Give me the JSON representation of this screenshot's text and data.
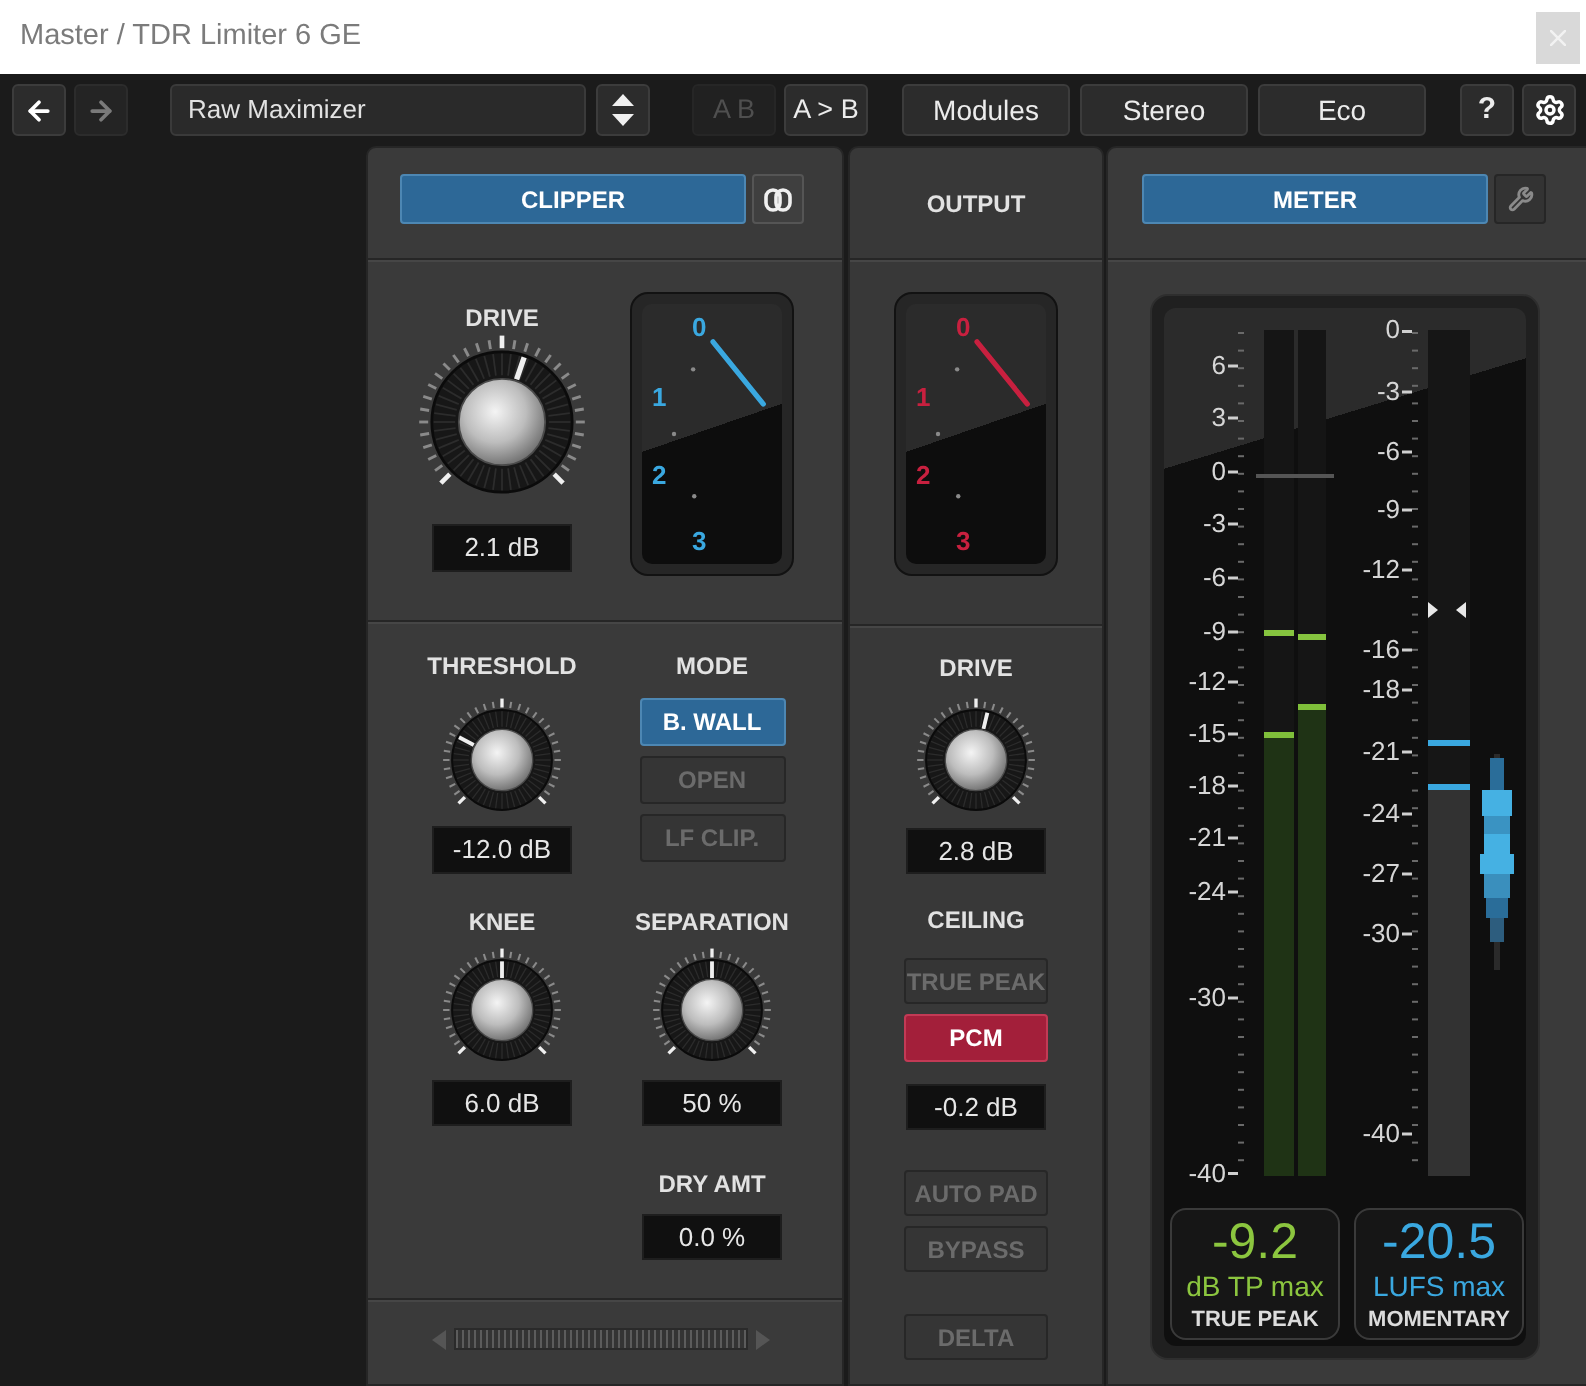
{
  "window": {
    "title": "Master / TDR Limiter 6 GE"
  },
  "toolbar": {
    "nav": [
      {
        "kind": "back",
        "disabled": false
      },
      {
        "kind": "forward",
        "disabled": true
      }
    ],
    "preset": "Raw Maximizer",
    "ab": [
      {
        "label": "A B",
        "disabled": true
      },
      {
        "label": "A > B",
        "disabled": false
      }
    ],
    "buttons": [
      {
        "label": "Modules"
      },
      {
        "label": "Stereo"
      },
      {
        "label": "Eco"
      }
    ],
    "help": "?"
  },
  "clipper": {
    "header": {
      "label": "CLIPPER",
      "on": true
    },
    "drive": {
      "label": "DRIVE",
      "value": "2.1 dB",
      "level": 0.57
    },
    "gr_meter": {
      "scale": [
        "0",
        "1",
        "2",
        "3"
      ]
    },
    "threshold": {
      "label": "THRESHOLD",
      "value": "-12.0 dB",
      "level": 0.27
    },
    "mode": {
      "label": "MODE",
      "options": [
        {
          "label": "B. WALL",
          "selected": true
        },
        {
          "label": "OPEN",
          "selected": false
        },
        {
          "label": "LF CLIP.",
          "selected": false
        }
      ]
    },
    "knee": {
      "label": "KNEE",
      "value": "6.0 dB",
      "level": 0.5
    },
    "separation": {
      "label": "SEPARATION",
      "value": "50 %",
      "level": 0.5
    },
    "dry_amount": {
      "label": "DRY AMT",
      "value": "0.0 %"
    }
  },
  "output": {
    "title": "OUTPUT",
    "gr_meter": {
      "scale": [
        "0",
        "1",
        "2",
        "3"
      ]
    },
    "drive": {
      "label": "DRIVE",
      "value": "2.8 dB",
      "level": 0.55
    },
    "ceiling": {
      "label": "CEILING",
      "options": [
        {
          "label": "TRUE PEAK",
          "selected": false
        },
        {
          "label": "PCM",
          "selected": true
        }
      ],
      "value": "-0.2 dB"
    },
    "buttons": [
      {
        "label": "AUTO PAD",
        "on": false
      },
      {
        "label": "BYPASS",
        "on": false
      },
      {
        "label": "DELTA",
        "on": false
      }
    ]
  },
  "meter": {
    "header": {
      "label": "METER",
      "on": true
    },
    "peak_scale": [
      "6",
      "3",
      "0",
      "-3",
      "-6",
      "-9",
      "-12",
      "-15",
      "-18",
      "-21",
      "-24",
      "-30",
      "-40"
    ],
    "peak_channels": [
      {
        "level": 0.525,
        "hold": {
          "level": 0.643
        }
      },
      {
        "level": 0.558,
        "hold": {
          "level": 0.638
        }
      }
    ],
    "loudness_scale": [
      "0",
      "-3",
      "-6",
      "-9",
      "-12",
      "-16",
      "-18",
      "-21",
      "-24",
      "-27",
      "-30",
      "-40"
    ],
    "loudness": {
      "level": 0.463,
      "hold": {
        "level": 0.511
      }
    },
    "readouts": [
      {
        "value": "-9.2",
        "unit": "dB TP max",
        "label": "TRUE PEAK",
        "color": "#8cc63f"
      },
      {
        "value": "-20.5",
        "unit": "LUFS max",
        "label": "MOMENTARY",
        "color": "#3aa8e0"
      }
    ]
  }
}
